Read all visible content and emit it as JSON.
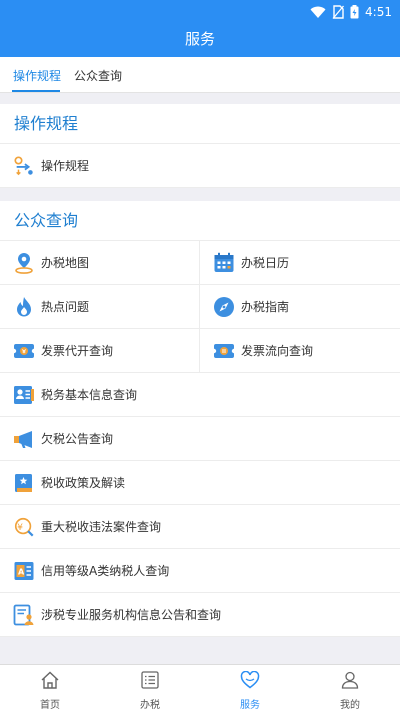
{
  "status": {
    "time": "4:51"
  },
  "header": {
    "title": "服务"
  },
  "tabs": [
    {
      "label": "操作规程",
      "active": true
    },
    {
      "label": "公众查询",
      "active": false
    }
  ],
  "sections": [
    {
      "title": "操作规程",
      "items": [
        {
          "label": "操作规程",
          "icon": "flow-icon"
        }
      ]
    },
    {
      "title": "公众查询",
      "items": [
        {
          "label": "办税地图",
          "icon": "map-pin-icon"
        },
        {
          "label": "办税日历",
          "icon": "calendar-icon"
        },
        {
          "label": "热点问题",
          "icon": "flame-icon"
        },
        {
          "label": "办税指南",
          "icon": "compass-icon"
        },
        {
          "label": "发票代开查询",
          "icon": "invoice-icon"
        },
        {
          "label": "发票流向查询",
          "icon": "invoice-flow-icon"
        },
        {
          "label": "税务基本信息查询",
          "icon": "id-card-icon"
        },
        {
          "label": "欠税公告查询",
          "icon": "megaphone-icon"
        },
        {
          "label": "税收政策及解读",
          "icon": "book-icon"
        },
        {
          "label": "重大税收违法案件查询",
          "icon": "tax-search-icon"
        },
        {
          "label": "信用等级A类纳税人查询",
          "icon": "credit-icon"
        },
        {
          "label": "涉税专业服务机构信息公告和查询",
          "icon": "document-person-icon"
        }
      ]
    }
  ],
  "bottom_nav": [
    {
      "label": "首页",
      "icon": "home-icon",
      "active": false
    },
    {
      "label": "办税",
      "icon": "list-icon",
      "active": false
    },
    {
      "label": "服务",
      "icon": "heart-icon",
      "active": true
    },
    {
      "label": "我的",
      "icon": "user-icon",
      "active": false
    }
  ],
  "colors": {
    "primary": "#2b8ef3",
    "section_title": "#1f7fd0",
    "background": "#efeff4"
  }
}
